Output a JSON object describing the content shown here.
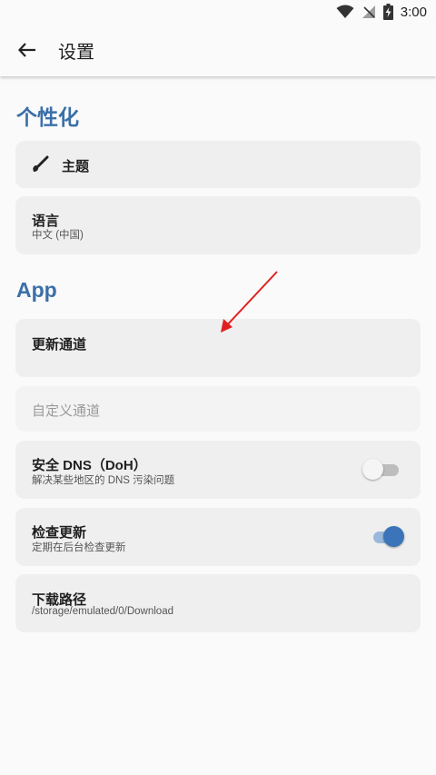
{
  "status_bar": {
    "time": "3:00"
  },
  "app_bar": {
    "title": "设置"
  },
  "sections": {
    "personalize": {
      "header": "个性化"
    },
    "app": {
      "header": "App"
    }
  },
  "items": {
    "theme": {
      "title": "主题"
    },
    "language": {
      "title": "语言",
      "subtitle": "中文 (中国)"
    },
    "update_channel": {
      "title": "更新通道"
    },
    "custom_channel": {
      "title": "自定义通道"
    },
    "secure_dns": {
      "title": "安全 DNS（DoH）",
      "subtitle": "解决某些地区的 DNS 污染问题",
      "enabled": false
    },
    "check_update": {
      "title": "检查更新",
      "subtitle": "定期在后台检查更新",
      "enabled": true
    },
    "download_path": {
      "title": "下载路径",
      "subtitle": "/storage/emulated/0/Download"
    }
  },
  "colors": {
    "accent": "#3b6fa8",
    "card": "#efefef",
    "background": "#fafafa",
    "annotation_arrow": "#e02020"
  },
  "icons": {
    "back": "arrow-left-icon",
    "theme": "brush-icon",
    "wifi": "wifi-icon",
    "signal": "no-signal-icon",
    "battery": "battery-charging-icon"
  }
}
